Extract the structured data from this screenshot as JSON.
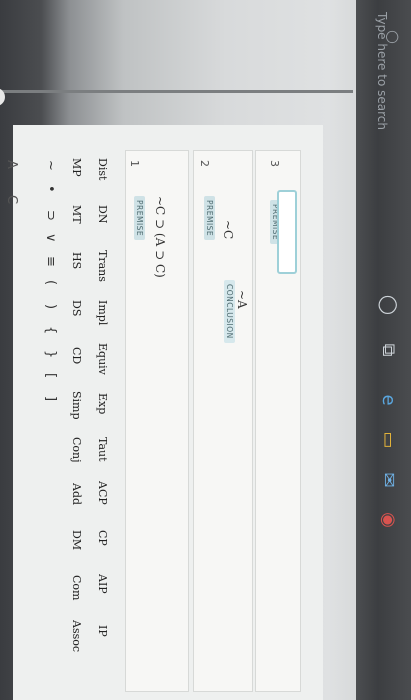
{
  "taskbar": {
    "search_placeholder": "Type here to search",
    "icons": [
      "cortana-icon",
      "task-view-icon",
      "edge-icon",
      "file-explorer-icon",
      "mail-icon",
      "chrome-icon"
    ]
  },
  "header": {
    "letters": [
      "A",
      "C"
    ]
  },
  "symbols": [
    "~",
    "•",
    "⊃",
    "∨",
    "≡",
    "(",
    ")",
    "{",
    "}",
    "[",
    "]"
  ],
  "rules": {
    "row1": [
      "MP",
      "MT",
      "HS",
      "DS",
      "CD",
      "Simp",
      "Conj",
      "Add",
      "DM",
      "Com",
      "Assoc"
    ],
    "row2": [
      "Dist",
      "DN",
      "Trans",
      "Impl",
      "Equiv",
      "Exp",
      "Taut",
      "ACP",
      "CP",
      "AIP",
      "IP"
    ]
  },
  "proof": {
    "premise_tag": "PREMISE",
    "conclusion_tag": "CONCLUSION",
    "lines": [
      {
        "number": "1",
        "formula": "~C ⊃ (A ⊃ C)",
        "tag": "PREMISE"
      },
      {
        "number": "2",
        "formula": "~C",
        "tag": "PREMISE",
        "conclusion_formula": "~A"
      },
      {
        "number": "3",
        "formula": "",
        "tag": "PREMISE"
      }
    ]
  },
  "colors": {
    "accent": "#9ed0d8",
    "tag_bg": "#cfe2e6"
  }
}
